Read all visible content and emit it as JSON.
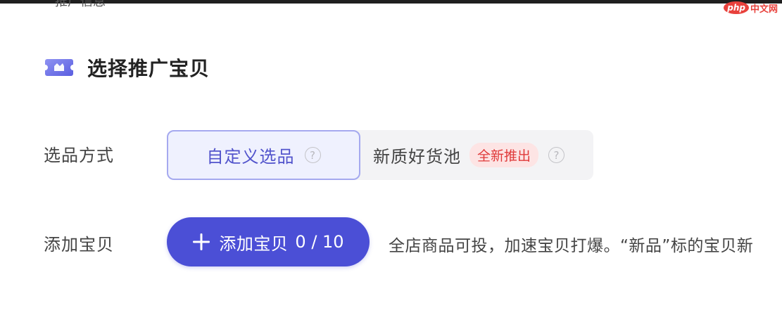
{
  "top_cut_text": "推广信息",
  "watermark": {
    "logo": "php",
    "text": "中文网"
  },
  "section": {
    "title": "选择推广宝贝",
    "icon": "ticket-icon"
  },
  "selection_method": {
    "label": "选品方式",
    "options": [
      {
        "label": "自定义选品",
        "selected": true,
        "help_icon": "question-circle-icon"
      },
      {
        "label": "新质好货池",
        "selected": false,
        "badge": "全新推出",
        "help_icon": "question-circle-icon"
      }
    ]
  },
  "add_items": {
    "label": "添加宝贝",
    "button_label": "添加宝贝",
    "count": "0 / 10",
    "hint": "全店商品可投，加速宝贝打爆。“新品”标的宝贝新"
  },
  "colors": {
    "accent": "#4b4fd6",
    "selected_border": "#a5a9ef",
    "selected_bg": "#eff1fe",
    "badge_text": "#e03a3a",
    "badge_bg": "#fde4e4"
  }
}
